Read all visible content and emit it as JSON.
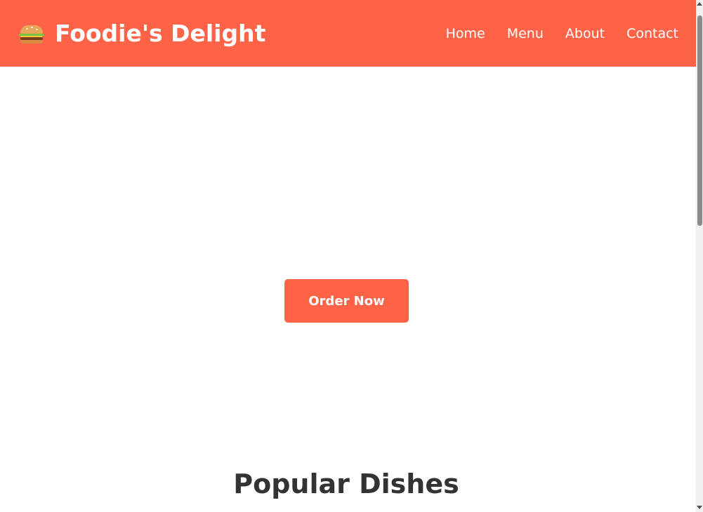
{
  "header": {
    "brand_icon": "hamburger-icon",
    "brand_title": "Foodie's Delight",
    "nav": [
      {
        "label": "Home"
      },
      {
        "label": "Menu"
      },
      {
        "label": "About"
      },
      {
        "label": "Contact"
      }
    ]
  },
  "hero": {
    "cta_label": "Order Now"
  },
  "popular": {
    "title": "Popular Dishes"
  },
  "colors": {
    "brand": "#ff6347",
    "text_dark": "#333333",
    "background": "#ffffff"
  }
}
